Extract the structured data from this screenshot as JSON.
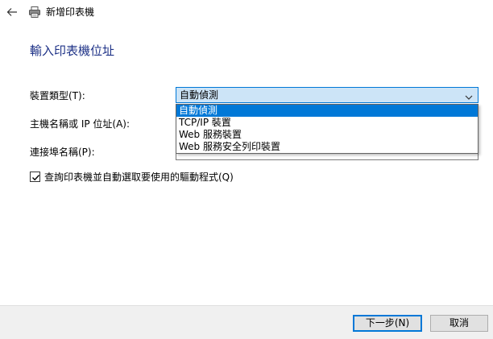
{
  "window": {
    "title": "新增印表機"
  },
  "page": {
    "heading": "輸入印表機位址"
  },
  "form": {
    "device_type_label": "裝置類型(T):",
    "device_type_value": "自動偵測",
    "hostname_label": "主機名稱或 IP 位址(A):",
    "hostname_value": "",
    "port_label": "連接埠名稱(P):",
    "port_value": "",
    "dropdown_options": [
      "自動偵測",
      "TCP/IP 裝置",
      "Web 服務裝置",
      "Web 服務安全列印裝置"
    ],
    "selected_option_index": 0,
    "query_checkbox_label": "查詢印表機並自動選取要使用的驅動程式(Q)",
    "query_checkbox_checked": true
  },
  "footer": {
    "next_label": "下一步(N)",
    "cancel_label": "取消"
  },
  "colors": {
    "accent": "#0078d7",
    "heading": "#1e3287",
    "combo_background": "#cce4f7",
    "footer_background": "#f0f0f0"
  },
  "icons": {
    "back": "back-arrow-icon",
    "printer": "printer-icon",
    "chevron": "chevron-down-icon",
    "check": "checkmark-icon"
  }
}
